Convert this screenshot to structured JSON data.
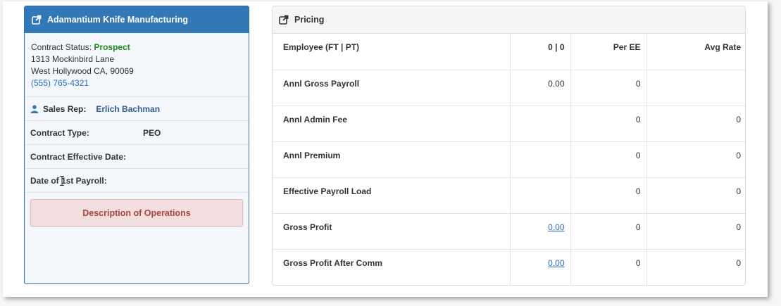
{
  "company": {
    "name": "Adamantium Knife Manufacturing",
    "status_label": "Contract Status:",
    "status_value": "Prospect",
    "address1": "1313 Mockinbird Lane",
    "address2": "West Hollywood CA, 90069",
    "phone": "(555) 765-4321"
  },
  "details": {
    "sales_rep_label": "Sales Rep:",
    "sales_rep_value": "Erlich Bachman",
    "contract_type_label": "Contract Type:",
    "contract_type_value": "PEO",
    "effective_date_label": "Contract Effective Date:",
    "effective_date_value": "",
    "first_payroll_label": "Date of 1st Payroll:",
    "first_payroll_value": ""
  },
  "description_button": "Description of Operations",
  "pricing": {
    "title": "Pricing",
    "headers": [
      "Employee (FT | PT)",
      "0 | 0",
      "Per EE",
      "Avg Rate"
    ],
    "rows": [
      {
        "label": "Annl Gross Payroll",
        "c1": "0.00",
        "c2": "0",
        "c3": ""
      },
      {
        "label": "Annl Admin Fee",
        "c1": "",
        "c2": "0",
        "c3": "0"
      },
      {
        "label": "Annl Premium",
        "c1": "",
        "c2": "0",
        "c3": "0"
      },
      {
        "label": "Effective Payroll Load",
        "c1": "",
        "c2": "0",
        "c3": "0"
      },
      {
        "label": "Gross Profit",
        "c1": "0.00",
        "c2": "0",
        "c3": "0"
      },
      {
        "label": "Gross Profit After Comm",
        "c1": "0.00",
        "c2": "0",
        "c3": "0"
      }
    ]
  },
  "colors": {
    "header_blue": "#3378b6",
    "status_green": "#1d8a1d",
    "link_blue": "#2a6ebb",
    "danger_text": "#a94442",
    "danger_bg": "#f2dede"
  },
  "icons": {
    "external_link": "external-link-icon",
    "user": "user-icon"
  }
}
